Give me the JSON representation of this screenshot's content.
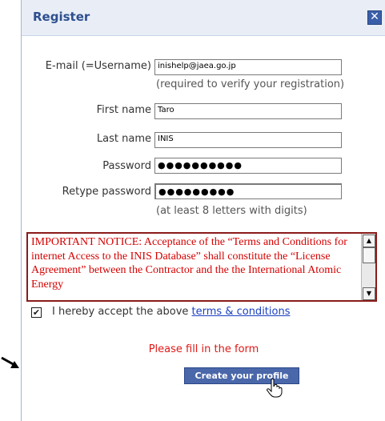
{
  "dialog": {
    "title": "Register",
    "close_label": "✕"
  },
  "form": {
    "email_label": "E-mail (=Username)",
    "email_value": "inishelp@jaea.go.jp",
    "email_hint": "(required to verify your registration)",
    "first_name_label": "First name",
    "first_name_value": "Taro",
    "last_name_label": "Last name",
    "last_name_value": "INIS",
    "password_label": "Password",
    "password_value": "●●●●●●●●●●",
    "retype_label": "Retype password",
    "retype_value": "●●●●●●●●●",
    "password_hint": "(at least 8 letters with digits)"
  },
  "notice": {
    "text": "IMPORTANT NOTICE: Acceptance of the “Terms and Conditions for internet Access to the INIS Database” shall constitute the “License Agreement” between the Contractor and the the International Atomic Energy"
  },
  "accept": {
    "checked": true,
    "text": "I hereby accept the above ",
    "link": "terms & conditions"
  },
  "status_message": "Please fill in the form",
  "create_button": "Create your profile",
  "colors": {
    "title": "#2d4f8f",
    "notice_text": "#d40000",
    "message": "#e01818",
    "button": "#4a67a9",
    "link": "#1a3fbf"
  }
}
